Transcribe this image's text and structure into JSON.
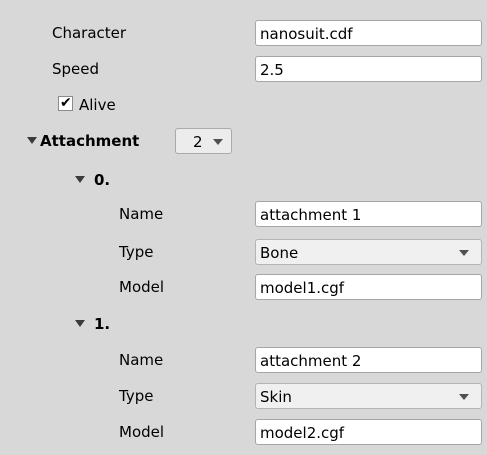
{
  "character": {
    "label": "Character",
    "value": "nanosuit.cdf"
  },
  "speed": {
    "label": "Speed",
    "value": "2.5"
  },
  "alive": {
    "label": "Alive",
    "checked": true,
    "check_glyph": "✔"
  },
  "attachment": {
    "label": "Attachment",
    "count": "2",
    "items": [
      {
        "index_label": "0.",
        "name": {
          "label": "Name",
          "value": "attachment 1"
        },
        "type": {
          "label": "Type",
          "value": "Bone"
        },
        "model": {
          "label": "Model",
          "value": "model1.cgf"
        }
      },
      {
        "index_label": "1.",
        "name": {
          "label": "Name",
          "value": "attachment 2"
        },
        "type": {
          "label": "Type",
          "value": "Skin"
        },
        "model": {
          "label": "Model",
          "value": "model2.cgf"
        }
      }
    ]
  },
  "colors": {
    "panel_bg": "#d8d8d8",
    "field_bg": "#ffffff",
    "select_bg": "#f0f0f0",
    "field_border": "#a6a6a6"
  }
}
